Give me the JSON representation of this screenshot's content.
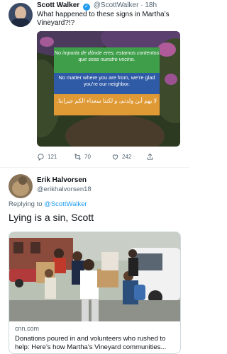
{
  "tweet": {
    "author_name": "Scott Walker",
    "author_handle": "@ScottWalker",
    "time": "18h",
    "text": "What happened to these signs in Martha’s Vineyard?!?",
    "sign": {
      "spanish": "No importa de dónde eres, estamos contentos que seas nuestro vecino.",
      "english": "No matter where you are from, we’re glad you’re our neighbor.",
      "arabic": "لا يهم أين ولدتم، و لكننا سعداء الكم جيراننا."
    },
    "stats": {
      "replies": "121",
      "retweets": "70",
      "likes": "242"
    }
  },
  "reply": {
    "author_name": "Erik Halvorsen",
    "author_handle": "@erikhalvorsen18",
    "replying_label": "Replying to",
    "replying_to": "@ScottWalker",
    "text": "Lying is a sin, Scott",
    "card": {
      "domain": "cnn.com",
      "title": "Donations poured in and volunteers who rushed to help: Here’s how Martha’s Vineyard communities..."
    }
  },
  "colors": {
    "link": "#1d9bf0",
    "muted": "#536471",
    "sign_green": "#3f9e4a",
    "sign_blue": "#2f5aa6",
    "sign_orange": "#e09a35"
  },
  "icons": [
    "reply-icon",
    "retweet-icon",
    "like-icon",
    "share-icon",
    "verified-badge-icon"
  ]
}
